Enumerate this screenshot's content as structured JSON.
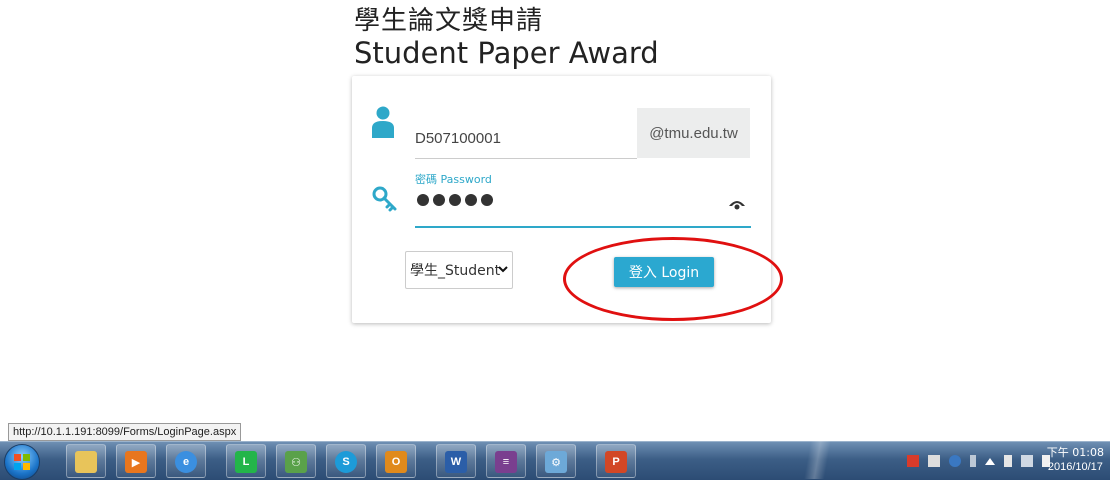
{
  "header": {
    "title_zh": "學生論文獎申請",
    "title_en": "Student Paper Award"
  },
  "login_form": {
    "username_value": "D507100001",
    "domain_suffix": "@tmu.edu.tw",
    "password_label": "密碼 Password",
    "password_masked": "●●●●●",
    "role_selected": "學生_Student",
    "login_button": "登入 Login"
  },
  "status_bar": {
    "url": "http://10.1.1.191:8099/Forms/LoginPage.aspx"
  },
  "taskbar": {
    "apps": [
      "start",
      "explorer",
      "media-player",
      "internet-explorer",
      "line",
      "people",
      "skype",
      "outlook",
      "word",
      "winrar",
      "control-panel",
      "powerpoint"
    ],
    "clock_time": "下午 01:08",
    "clock_date": "2016/10/17"
  },
  "colors": {
    "accent": "#2ba8d0",
    "annotation": "#e01010",
    "taskbar": "#3c5e86"
  }
}
